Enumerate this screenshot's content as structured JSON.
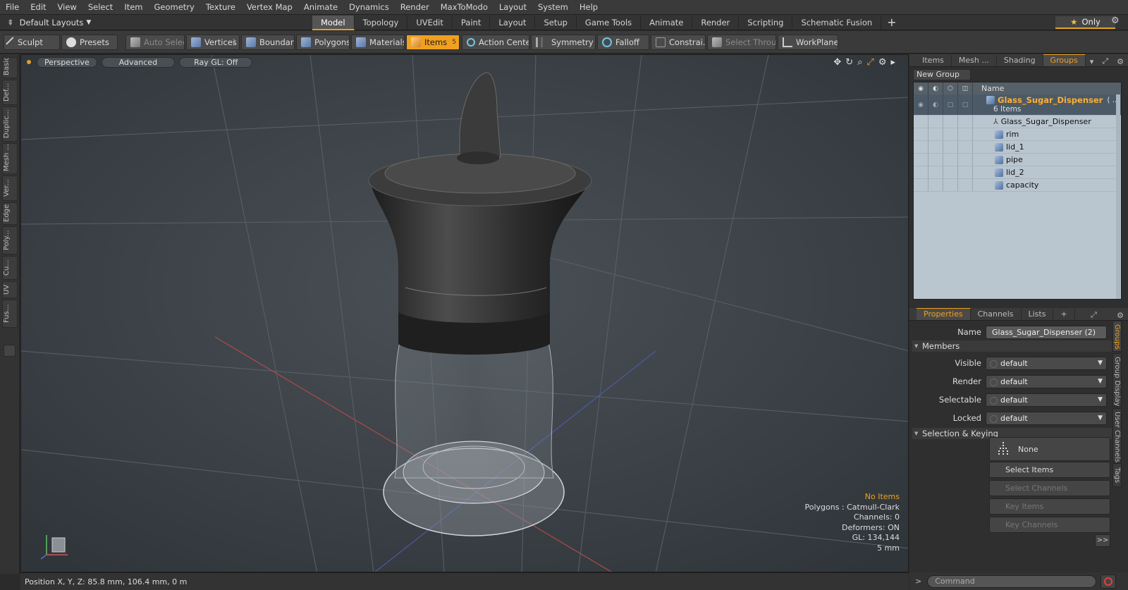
{
  "menubar": {
    "items": [
      "File",
      "Edit",
      "View",
      "Select",
      "Item",
      "Geometry",
      "Texture",
      "Vertex Map",
      "Animate",
      "Dynamics",
      "Render",
      "MaxToModo",
      "Layout",
      "System",
      "Help"
    ]
  },
  "layoutbar": {
    "layout_name": "Default Layouts",
    "tabs": [
      "Model",
      "Topology",
      "UVEdit",
      "Paint",
      "Layout",
      "Setup",
      "Game Tools",
      "Animate",
      "Render",
      "Scripting",
      "Schematic Fusion"
    ],
    "active_tab": "Model",
    "only_label": "Only"
  },
  "toolbar": {
    "sculpt": "Sculpt",
    "presets": "Presets",
    "auto_select": "Auto Select",
    "vertices": "Vertices",
    "vertices_count": "1",
    "boundary": "Boundary",
    "polygons": "Polygons",
    "materials": "Materials",
    "items": "Items",
    "items_count": "5",
    "action_center": "Action Center",
    "symmetry": "Symmetry",
    "falloff": "Falloff",
    "constraints": "Constrai...",
    "select_through": "Select Through",
    "workplane": "WorkPlane"
  },
  "left_tabs": [
    "Basic",
    "Def...",
    "Duplic...",
    "Mesh ...",
    "Ver...",
    "Edge",
    "Poly...",
    "Cu...",
    "UV",
    "Fus..."
  ],
  "viewport": {
    "perspective": "Perspective",
    "advanced": "Advanced",
    "raygl": "Ray GL: Off",
    "stats": {
      "no_items": "No Items",
      "polygons": "Polygons : Catmull-Clark",
      "channels": "Channels: 0",
      "deformers": "Deformers: ON",
      "gl": "GL: 134,144",
      "scale": "5 mm"
    }
  },
  "statusbar": {
    "position": "Position X, Y, Z:  85.8 mm, 106.4 mm, 0 m"
  },
  "groups_panel": {
    "tabs": [
      "Items",
      "Mesh ...",
      "Shading",
      "Groups"
    ],
    "active_tab": "Groups",
    "new_group": "New Group",
    "name_header": "Name",
    "group_name": "Glass_Sugar_Dispenser",
    "group_suffix": "( ...",
    "group_count": "6 Items",
    "children": [
      "Glass_Sugar_Dispenser",
      "rim",
      "lid_1",
      "pipe",
      "lid_2",
      "capacity"
    ]
  },
  "properties_panel": {
    "tabs": [
      "Properties",
      "Channels",
      "Lists"
    ],
    "active_tab": "Properties",
    "name_label": "Name",
    "name_value": "Glass_Sugar_Dispenser (2)",
    "members_section": "Members",
    "visible_label": "Visible",
    "render_label": "Render",
    "selectable_label": "Selectable",
    "locked_label": "Locked",
    "default_value": "default",
    "selection_section": "Selection & Keying",
    "none_label": "None",
    "select_items": "Select Items",
    "select_channels": "Select Channels",
    "key_items": "Key Items",
    "key_channels": "Key Channels",
    "more": ">>",
    "side_tabs": [
      "Groups",
      "Group Display",
      "User Channels",
      "Tags"
    ]
  },
  "command": {
    "prompt": ">",
    "placeholder": "Command"
  },
  "colors": {
    "accent": "#f0a020",
    "group_name": "#ffb030"
  }
}
